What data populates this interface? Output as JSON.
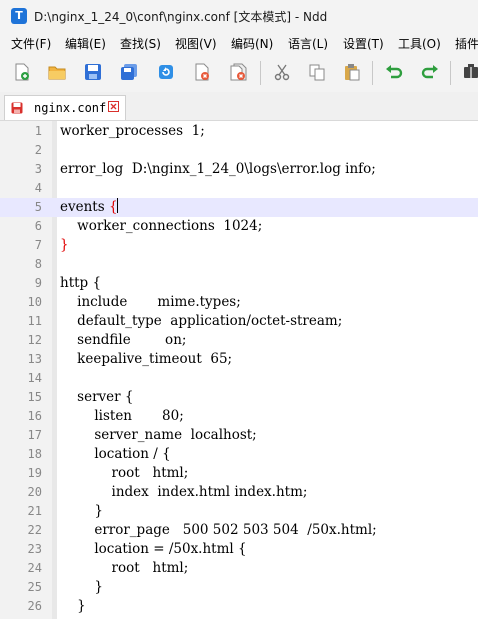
{
  "window": {
    "title": "D:\\nginx_1_24_0\\conf\\nginx.conf [文本模式] - Ndd",
    "icon_letter": "T"
  },
  "menu": [
    {
      "label": "文件(F)"
    },
    {
      "label": "编辑(E)"
    },
    {
      "label": "查找(S)"
    },
    {
      "label": "视图(V)"
    },
    {
      "label": "编码(N)"
    },
    {
      "label": "语言(L)"
    },
    {
      "label": "设置(T)"
    },
    {
      "label": "工具(O)"
    },
    {
      "label": "插件"
    }
  ],
  "toolbar": {
    "buttons": [
      "new-file-icon",
      "open-file-icon",
      "save-icon",
      "save-all-icon",
      "reload-icon",
      "close-icon",
      "close-all-icon",
      "cut-icon",
      "copy-icon",
      "paste-icon",
      "undo-icon",
      "redo-icon",
      "plugin-icon"
    ]
  },
  "tab": {
    "label": "nginx.conf",
    "modified_color": "#d9302c"
  },
  "editor": {
    "current_line": 5,
    "lines": [
      {
        "n": "1",
        "text": "worker_processes  1;"
      },
      {
        "n": "2",
        "text": ""
      },
      {
        "n": "3",
        "text": "error_log  D:\\nginx_1_24_0\\logs\\error.log info;"
      },
      {
        "n": "4",
        "text": ""
      },
      {
        "n": "5",
        "text": "events ",
        "brace": "{"
      },
      {
        "n": "6",
        "text": "    worker_connections  1024;"
      },
      {
        "n": "7",
        "text": "",
        "brace": "}"
      },
      {
        "n": "8",
        "text": ""
      },
      {
        "n": "9",
        "text": "http {"
      },
      {
        "n": "10",
        "text": "    include       mime.types;"
      },
      {
        "n": "11",
        "text": "    default_type  application/octet-stream;"
      },
      {
        "n": "12",
        "text": "    sendfile        on;"
      },
      {
        "n": "13",
        "text": "    keepalive_timeout  65;"
      },
      {
        "n": "14",
        "text": ""
      },
      {
        "n": "15",
        "text": "    server {"
      },
      {
        "n": "16",
        "text": "        listen       80;"
      },
      {
        "n": "17",
        "text": "        server_name  localhost;"
      },
      {
        "n": "18",
        "text": "        location / {"
      },
      {
        "n": "19",
        "text": "            root   html;"
      },
      {
        "n": "20",
        "text": "            index  index.html index.htm;"
      },
      {
        "n": "21",
        "text": "        }"
      },
      {
        "n": "22",
        "text": "        error_page   500 502 503 504  /50x.html;"
      },
      {
        "n": "23",
        "text": "        location = /50x.html {"
      },
      {
        "n": "24",
        "text": "            root   html;"
      },
      {
        "n": "25",
        "text": "        }"
      },
      {
        "n": "26",
        "text": "    }"
      }
    ]
  },
  "colors": {
    "brace_match": "#e00000",
    "current_line_bg": "#e8e8ff",
    "gutter_bg": "#f2f2f2"
  }
}
